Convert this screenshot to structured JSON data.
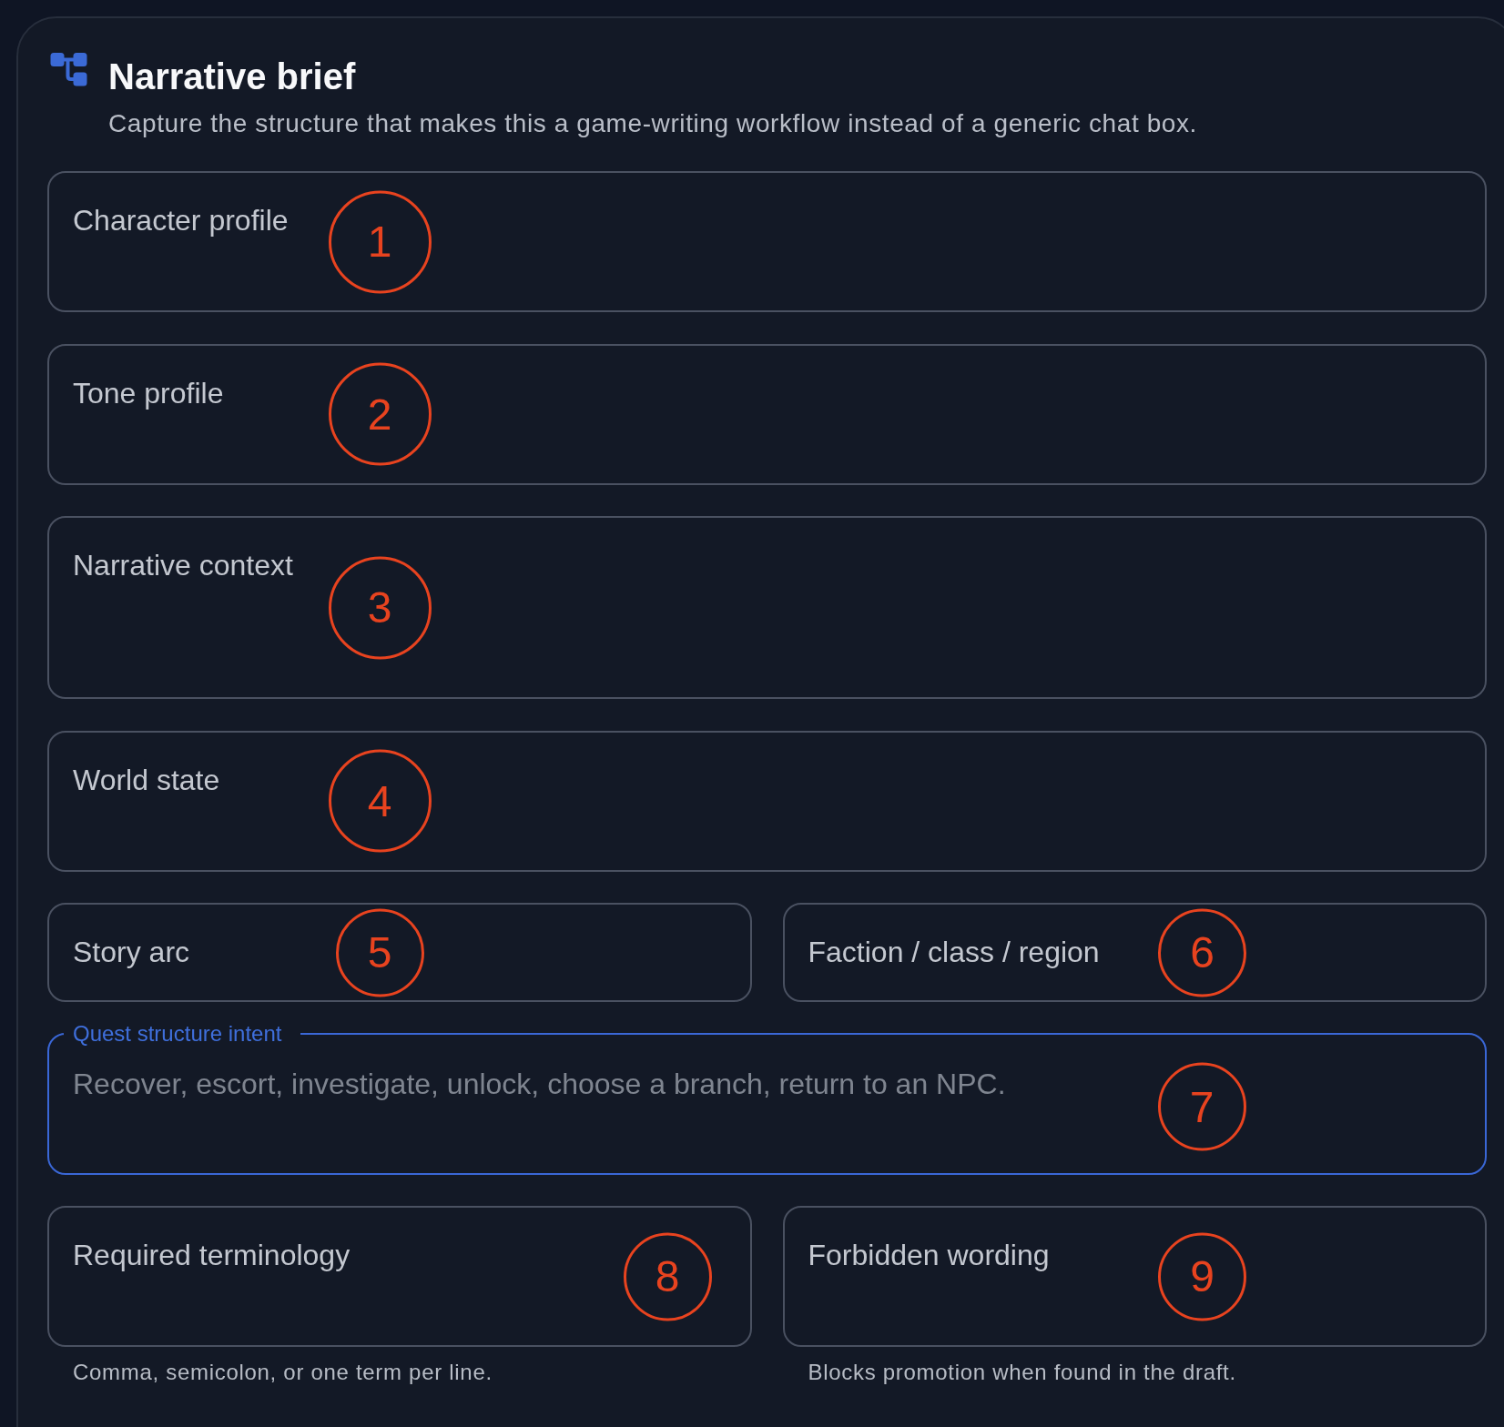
{
  "panel": {
    "title": "Narrative brief",
    "description": "Capture the structure that makes this a game-writing workflow instead of a generic chat box."
  },
  "form": {
    "rows": [
      [
        {
          "label": "Character profile",
          "kind": "textarea",
          "focused": false,
          "callout": "1"
        }
      ],
      [
        {
          "label": "Tone profile",
          "kind": "textarea",
          "focused": false,
          "callout": "2"
        }
      ],
      [
        {
          "label": "Narrative context",
          "kind": "bigtextarea",
          "focused": false,
          "callout": "3"
        }
      ],
      [
        {
          "label": "World state",
          "kind": "textarea",
          "focused": false,
          "callout": "4"
        }
      ],
      [
        {
          "label": "Story arc",
          "kind": "input",
          "focused": false,
          "callout": "5"
        },
        {
          "label": "Faction / class / region",
          "kind": "input",
          "focused": false,
          "callout": "6"
        }
      ],
      [
        {
          "label": "Quest structure intent",
          "kind": "textarea",
          "focused": true,
          "placeholder": "Recover, escort, investigate, unlock, choose a branch, return to an NPC.",
          "callout": "7"
        }
      ],
      [
        {
          "label": "Required terminology",
          "kind": "textarea",
          "focused": false,
          "callout": "8",
          "hint": "Comma, semicolon, or one term per line."
        },
        {
          "label": "Forbidden wording",
          "kind": "textarea",
          "focused": false,
          "callout": "9",
          "hint": "Blocks promotion when found in the draft."
        }
      ]
    ]
  }
}
